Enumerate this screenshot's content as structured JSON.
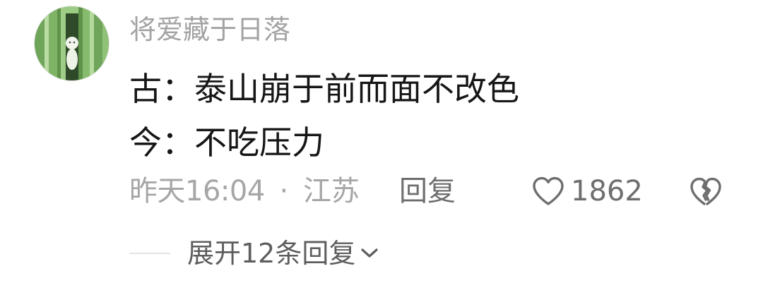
{
  "comment": {
    "username": "将爱藏于日落",
    "content_lines": [
      "古：泰山崩于前而面不改色",
      "今：不吃压力"
    ],
    "time": "昨天16:04",
    "separator": "·",
    "location": "江苏",
    "reply_label": "回复",
    "like_count": "1862",
    "expand_label": "展开12条回复"
  },
  "icons": {
    "avatar": "avatar-image",
    "like": "heart-outline-icon",
    "dislike": "broken-heart-icon",
    "expand": "chevron-down-icon"
  },
  "colors": {
    "username": "#a3a3a3",
    "content": "#161616",
    "meta": "#a6a6a6",
    "action": "#6e6e6e",
    "avatar_green": "#7fb466"
  }
}
